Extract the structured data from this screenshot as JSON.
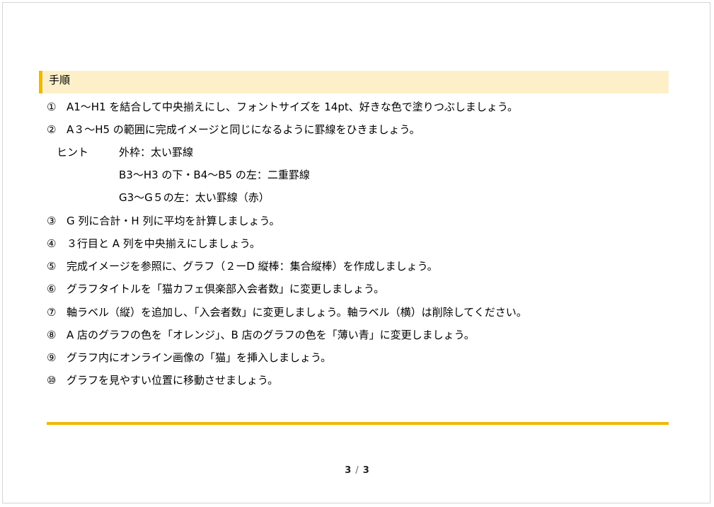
{
  "section": {
    "title": "手順"
  },
  "steps": [
    {
      "num": "①",
      "text": "A1～H1 を結合して中央揃えにし、フォントサイズを 14pt、好きな色で塗りつぶしましょう。"
    },
    {
      "num": "②",
      "text": "A３～H5 の範囲に完成イメージと同じになるように罫線をひきましょう。"
    },
    {
      "num": "③",
      "text": "G 列に合計・H 列に平均を計算しましょう。"
    },
    {
      "num": "④",
      "text": "３行目と A 列を中央揃えにしましょう。"
    },
    {
      "num": "⑤",
      "text": "完成イメージを参照に、グラフ（２ーD 縦棒：集合縦棒）を作成しましょう。"
    },
    {
      "num": "⑥",
      "text": "グラフタイトルを「猫カフェ倶楽部入会者数」に変更しましょう。"
    },
    {
      "num": "⑦",
      "text": "軸ラベル（縦）を追加し、「入会者数」に変更しましょう。軸ラベル（横）は削除してください。"
    },
    {
      "num": "⑧",
      "text": "A 店のグラフの色を「オレンジ」、B 店のグラフの色を「薄い青」に変更しましょう。"
    },
    {
      "num": "⑨",
      "text": "グラフ内にオンライン画像の「猫」を挿入しましょう。"
    },
    {
      "num": "⑩",
      "text": "グラフを見やすい位置に移動させましょう。"
    }
  ],
  "hint": {
    "label": "ヒント",
    "lines": [
      "外枠：太い罫線",
      "B3～H3 の下・B4～B5 の左：二重罫線",
      "G3～G５の左：太い罫線（赤）"
    ]
  },
  "pagination": {
    "current": "3",
    "separator": "/",
    "total": "3"
  },
  "colors": {
    "accent": "#f0b800",
    "heading_bg": "#fdf0c8"
  }
}
